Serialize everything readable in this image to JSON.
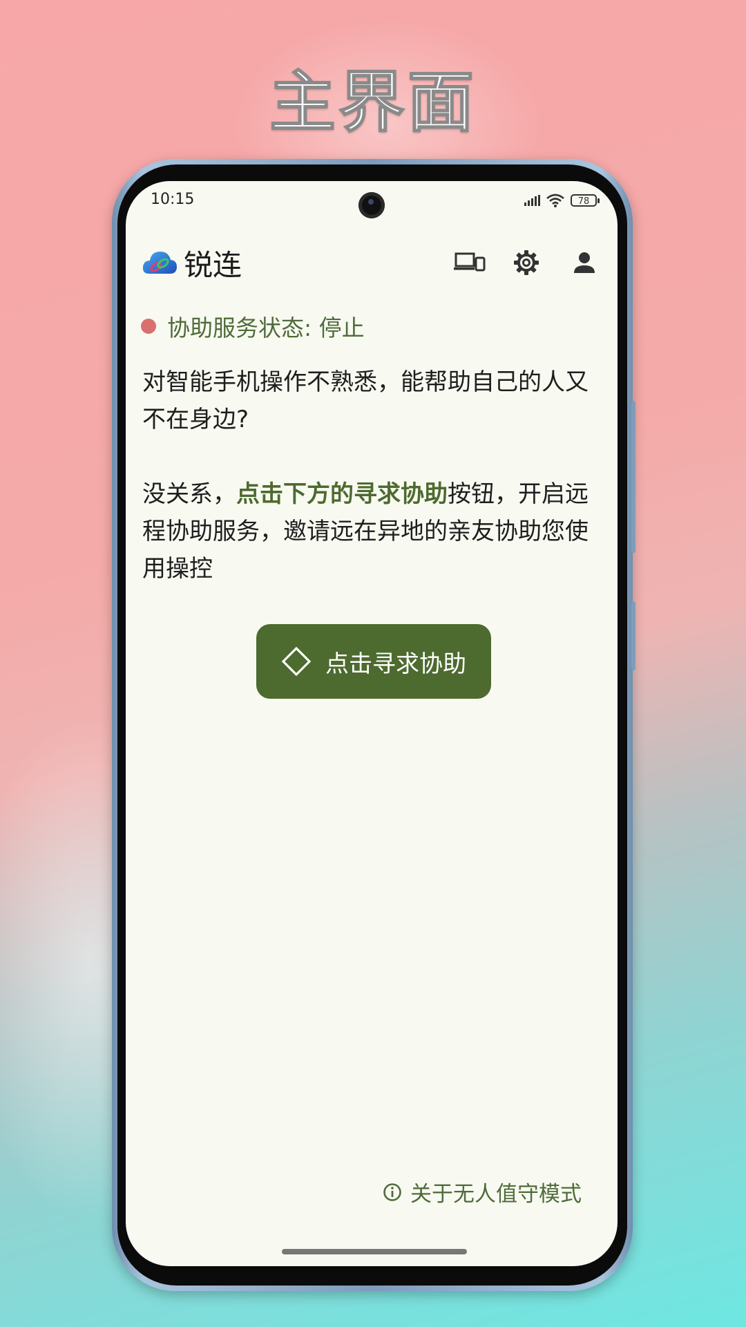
{
  "page": {
    "headline": "主界面"
  },
  "status_bar": {
    "time": "10:15",
    "battery": "78"
  },
  "app_bar": {
    "title": "锐连",
    "actions": [
      "devices-icon",
      "settings-icon",
      "account-icon"
    ]
  },
  "service_status": {
    "label": "协助服务状态: 停止",
    "dot_color": "#d9706f"
  },
  "intro": {
    "paragraph1": "对智能手机操作不熟悉，能帮助自己的人又不在身边?",
    "paragraph2_prefix": "没关系，",
    "paragraph2_highlight": "点击下方的寻求协助",
    "paragraph2_suffix": "按钮，开启远程协助服务，邀请远在异地的亲友协助您使用操控"
  },
  "primary_button": {
    "label": "点击寻求协助",
    "icon": "diamond-icon"
  },
  "footer_link": {
    "label": "关于无人值守模式",
    "icon": "info-icon"
  },
  "colors": {
    "accent": "#4d6a2f",
    "screen_background": "#f8faf1",
    "status_text": "#4f6b3a"
  }
}
